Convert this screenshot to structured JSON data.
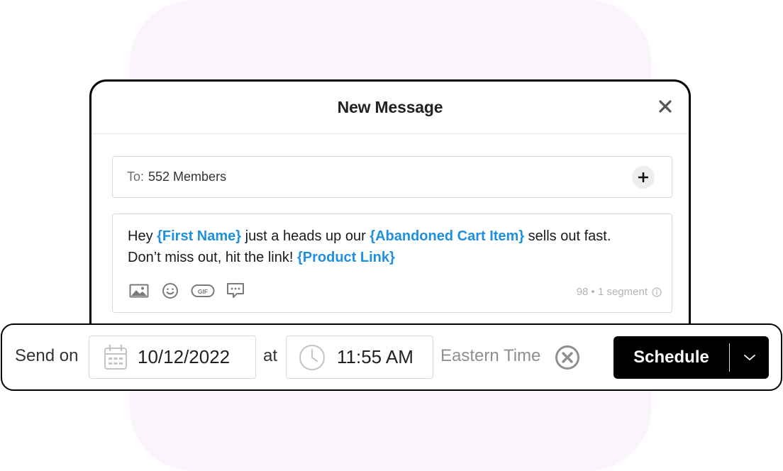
{
  "modal": {
    "title": "New Message",
    "to_label": "To:",
    "to_value": "552 Members",
    "message": {
      "line1": [
        {
          "text": "Hey ",
          "token": false
        },
        {
          "text": "{First Name}",
          "token": true
        },
        {
          "text": " just a heads up our ",
          "token": false
        },
        {
          "text": "{Abandoned Cart Item}",
          "token": true
        },
        {
          "text": " sells out fast.",
          "token": false
        }
      ],
      "line2": [
        {
          "text": "Don’t miss out, hit the link! ",
          "token": false
        },
        {
          "text": "{Product Link}",
          "token": true
        }
      ]
    },
    "tools": [
      "image-icon",
      "emoji-icon",
      "gif-icon",
      "message-bubble-icon"
    ],
    "gif_label": "GIF",
    "segment_info": "98 • 1 segment"
  },
  "schedule": {
    "send_on_label": "Send on",
    "date": "10/12/2022",
    "at_label": "at",
    "time": "11:55 AM",
    "timezone": "Eastern Time",
    "button_label": "Schedule"
  },
  "colors": {
    "accent_token": "#1f8fe0",
    "background_card": "#fcf4fd",
    "button": "#000000"
  }
}
